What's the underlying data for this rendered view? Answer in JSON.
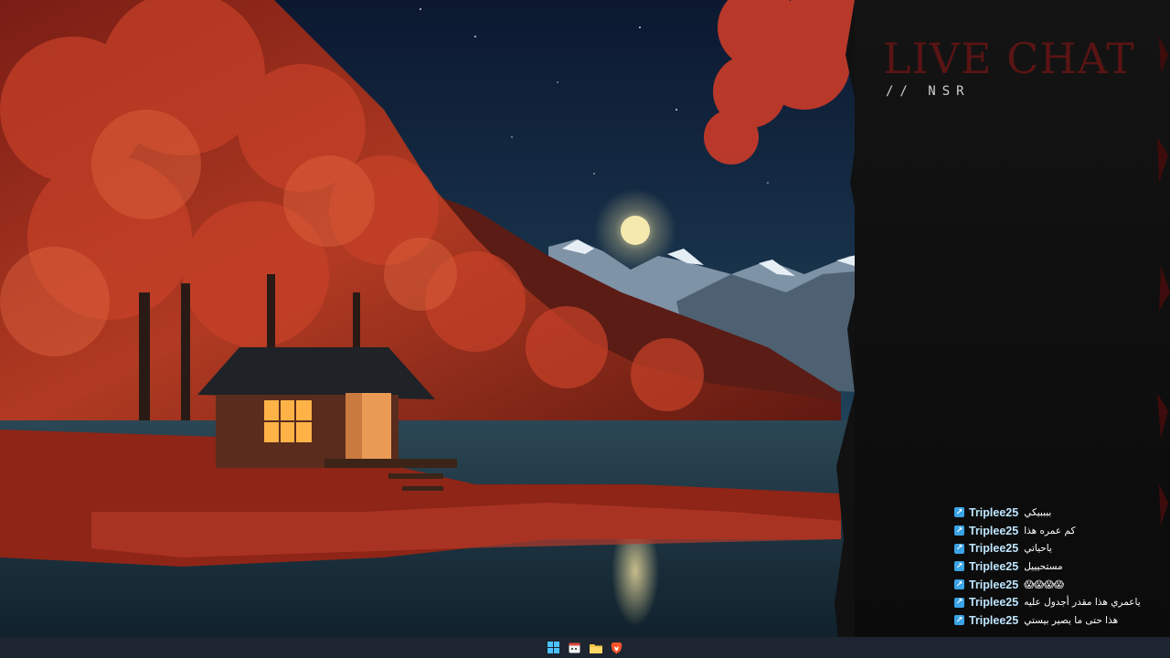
{
  "live_chat": {
    "title": "LIVE CHAT",
    "subtitle": "// NSR",
    "title_color": "#5a1414",
    "messages": [
      {
        "user": "Triplee25",
        "text": "ببببيكي"
      },
      {
        "user": "Triplee25",
        "text": "كم عمره هذا"
      },
      {
        "user": "Triplee25",
        "text": "ياحياتي"
      },
      {
        "user": "Triplee25",
        "text": "مستحيييل"
      },
      {
        "user": "Triplee25",
        "text": "😱😱😱😱"
      },
      {
        "user": "Triplee25",
        "text": "ياعمري هذا مقدر أجدول عليه"
      },
      {
        "user": "Triplee25",
        "text": "هذا حتى ما يصير بيستي"
      }
    ],
    "user_color": "#bfe6ff",
    "badge_color": "#3aa3e6"
  },
  "taskbar": {
    "icons": [
      "windows-start-icon",
      "calendar-app-icon",
      "file-explorer-icon",
      "brave-browser-icon"
    ],
    "background": "#1c2530"
  },
  "wallpaper": {
    "palette": {
      "sky": "#0f2238",
      "moon": "#f4e6a6",
      "foliage": "#b4301f",
      "lake": "#1e3b4a",
      "cabin_light": "#ffb347"
    }
  }
}
